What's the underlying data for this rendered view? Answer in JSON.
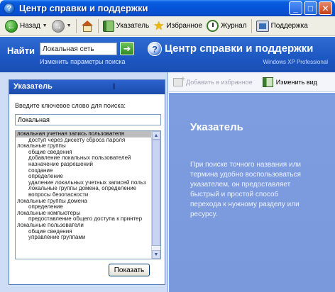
{
  "window": {
    "title": "Центр справки и поддержки",
    "minimize_glyph": "_",
    "maximize_glyph": "□",
    "close_glyph": "✕"
  },
  "toolbar": {
    "back_label": "Назад",
    "index_label": "Указатель",
    "favorites_label": "Избранное",
    "history_label": "Журнал",
    "support_label": "Поддержка"
  },
  "header": {
    "find_label": "Найти",
    "search_value": "Локальная сеть",
    "search_options_link": "Изменить параметры поиска",
    "brand_title": "Центр справки и поддержки",
    "edition": "Windows XP Professional"
  },
  "index_panel": {
    "title": "Указатель",
    "prompt": "Введите ключевое слово для поиска:",
    "keyword_value": "Локальная",
    "items": [
      {
        "text": "локальная учетная запись пользователя",
        "level": 0,
        "selected": true
      },
      {
        "text": "доступ через дискету сброса пароля",
        "level": 1,
        "selected": false
      },
      {
        "text": "локальные группы",
        "level": 0,
        "selected": false
      },
      {
        "text": "общие сведения",
        "level": 1,
        "selected": false
      },
      {
        "text": "добавление локальных пользователей",
        "level": 1,
        "selected": false
      },
      {
        "text": "назначение разрешений",
        "level": 1,
        "selected": false
      },
      {
        "text": "создание",
        "level": 1,
        "selected": false
      },
      {
        "text": "определение",
        "level": 1,
        "selected": false
      },
      {
        "text": "удаление локальных учетных записей польз",
        "level": 1,
        "selected": false
      },
      {
        "text": "локальные группы домена, определение",
        "level": 1,
        "selected": false
      },
      {
        "text": "вопросы безопасности",
        "level": 1,
        "selected": false
      },
      {
        "text": "локальные группы домена",
        "level": 0,
        "selected": false
      },
      {
        "text": "определение",
        "level": 1,
        "selected": false
      },
      {
        "text": "локальные компьютеры",
        "level": 0,
        "selected": false
      },
      {
        "text": "предоставление общего доступа к принтер",
        "level": 1,
        "selected": false
      },
      {
        "text": "локальные пользователи",
        "level": 0,
        "selected": false
      },
      {
        "text": "общие сведения",
        "level": 1,
        "selected": false
      },
      {
        "text": "управление группами",
        "level": 1,
        "selected": false
      }
    ],
    "show_button": "Показать"
  },
  "right_pane": {
    "add_favorites_label": "Добавить в избранное",
    "change_view_label": "Изменить вид",
    "title": "Указатель",
    "description": "При поиске точного названия или термина удобно воспользоваться указателем, он предоставляет быстрый и простой способ перехода к нужному разделу или ресурсу."
  }
}
